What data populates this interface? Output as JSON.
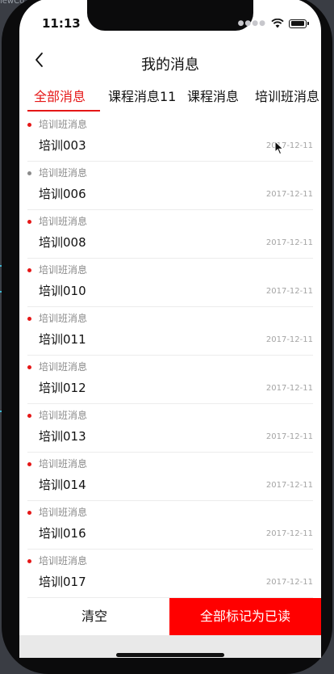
{
  "desktop": {
    "label": "iewCo"
  },
  "status_bar": {
    "time": "11:13"
  },
  "navbar": {
    "title": "我的消息"
  },
  "tabs": [
    {
      "label": "全部消息",
      "active": true
    },
    {
      "label": "课程消息11",
      "active": false
    },
    {
      "label": "课程消息",
      "active": false
    },
    {
      "label": "培训班消息",
      "active": false
    }
  ],
  "messages": [
    {
      "category": "培训班消息",
      "title": "培训003",
      "date": "2017-12-11",
      "unread": true
    },
    {
      "category": "培训班消息",
      "title": "培训006",
      "date": "2017-12-11",
      "unread": false
    },
    {
      "category": "培训班消息",
      "title": "培训008",
      "date": "2017-12-11",
      "unread": true
    },
    {
      "category": "培训班消息",
      "title": "培训010",
      "date": "2017-12-11",
      "unread": true
    },
    {
      "category": "培训班消息",
      "title": "培训011",
      "date": "2017-12-11",
      "unread": true
    },
    {
      "category": "培训班消息",
      "title": "培训012",
      "date": "2017-12-11",
      "unread": true
    },
    {
      "category": "培训班消息",
      "title": "培训013",
      "date": "2017-12-11",
      "unread": true
    },
    {
      "category": "培训班消息",
      "title": "培训014",
      "date": "2017-12-11",
      "unread": true
    },
    {
      "category": "培训班消息",
      "title": "培训016",
      "date": "2017-12-11",
      "unread": true
    },
    {
      "category": "培训班消息",
      "title": "培训017",
      "date": "2017-12-11",
      "unread": true
    }
  ],
  "bottom_bar": {
    "clear_label": "清空",
    "mark_all_label": "全部标记为已读"
  },
  "colors": {
    "accent": "#e51717",
    "unread_dot": "#e51717",
    "read_dot": "#8a8a8a",
    "primary_button": "#ff0000"
  },
  "icons": {
    "back": "chevron-left-icon",
    "wifi": "wifi-icon",
    "battery": "battery-icon",
    "cursor": "mouse-cursor-icon"
  }
}
